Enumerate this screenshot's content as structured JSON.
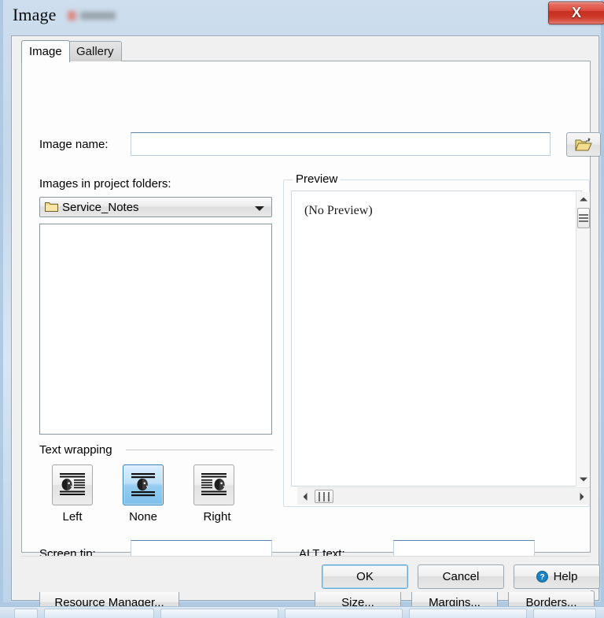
{
  "window": {
    "title": "Image",
    "close_label": "X",
    "close_icon": "close-icon"
  },
  "tabs": [
    {
      "label": "Image",
      "active": true
    },
    {
      "label": "Gallery",
      "active": false
    }
  ],
  "form": {
    "image_name_label": "Image name:",
    "image_name_value": "",
    "image_name_placeholder": "",
    "browse_icon": "folder-open-icon",
    "folders_label": "Images in project folders:",
    "folder_selected": "Service_Notes",
    "folder_icon": "folder-icon",
    "dropdown_icon": "chevron-down-icon"
  },
  "text_wrapping": {
    "legend": "Text wrapping",
    "options": [
      {
        "label": "Left",
        "icon": "wrap-left-icon",
        "selected": false
      },
      {
        "label": "None",
        "icon": "wrap-none-icon",
        "selected": true
      },
      {
        "label": "Right",
        "icon": "wrap-right-icon",
        "selected": false
      }
    ]
  },
  "preview": {
    "legend": "Preview",
    "empty_text": "(No Preview)",
    "scroll_up_icon": "scroll-up-arrow-icon",
    "scroll_down_icon": "scroll-down-arrow-icon",
    "scroll_left_icon": "scroll-left-arrow-icon",
    "scroll_right_icon": "scroll-right-arrow-icon"
  },
  "fields": {
    "screen_tip_label": "Screen tip:",
    "screen_tip_value": "",
    "alt_text_label": "ALT text:",
    "alt_text_value": ""
  },
  "actions": {
    "resource_manager": "Resource Manager...",
    "size": "Size...",
    "margins": "Margins...",
    "borders": "Borders..."
  },
  "footer": {
    "ok": "OK",
    "cancel": "Cancel",
    "help": "Help",
    "help_icon": "help-circle-icon"
  },
  "colors": {
    "accent_blue": "#2e7dba",
    "selected_fill": "#7ec0ea",
    "close_red": "#c62f21",
    "help_blue": "#1a82c4",
    "folder_yellow": "#e8c85a",
    "window_chrome": "#cdddee"
  }
}
